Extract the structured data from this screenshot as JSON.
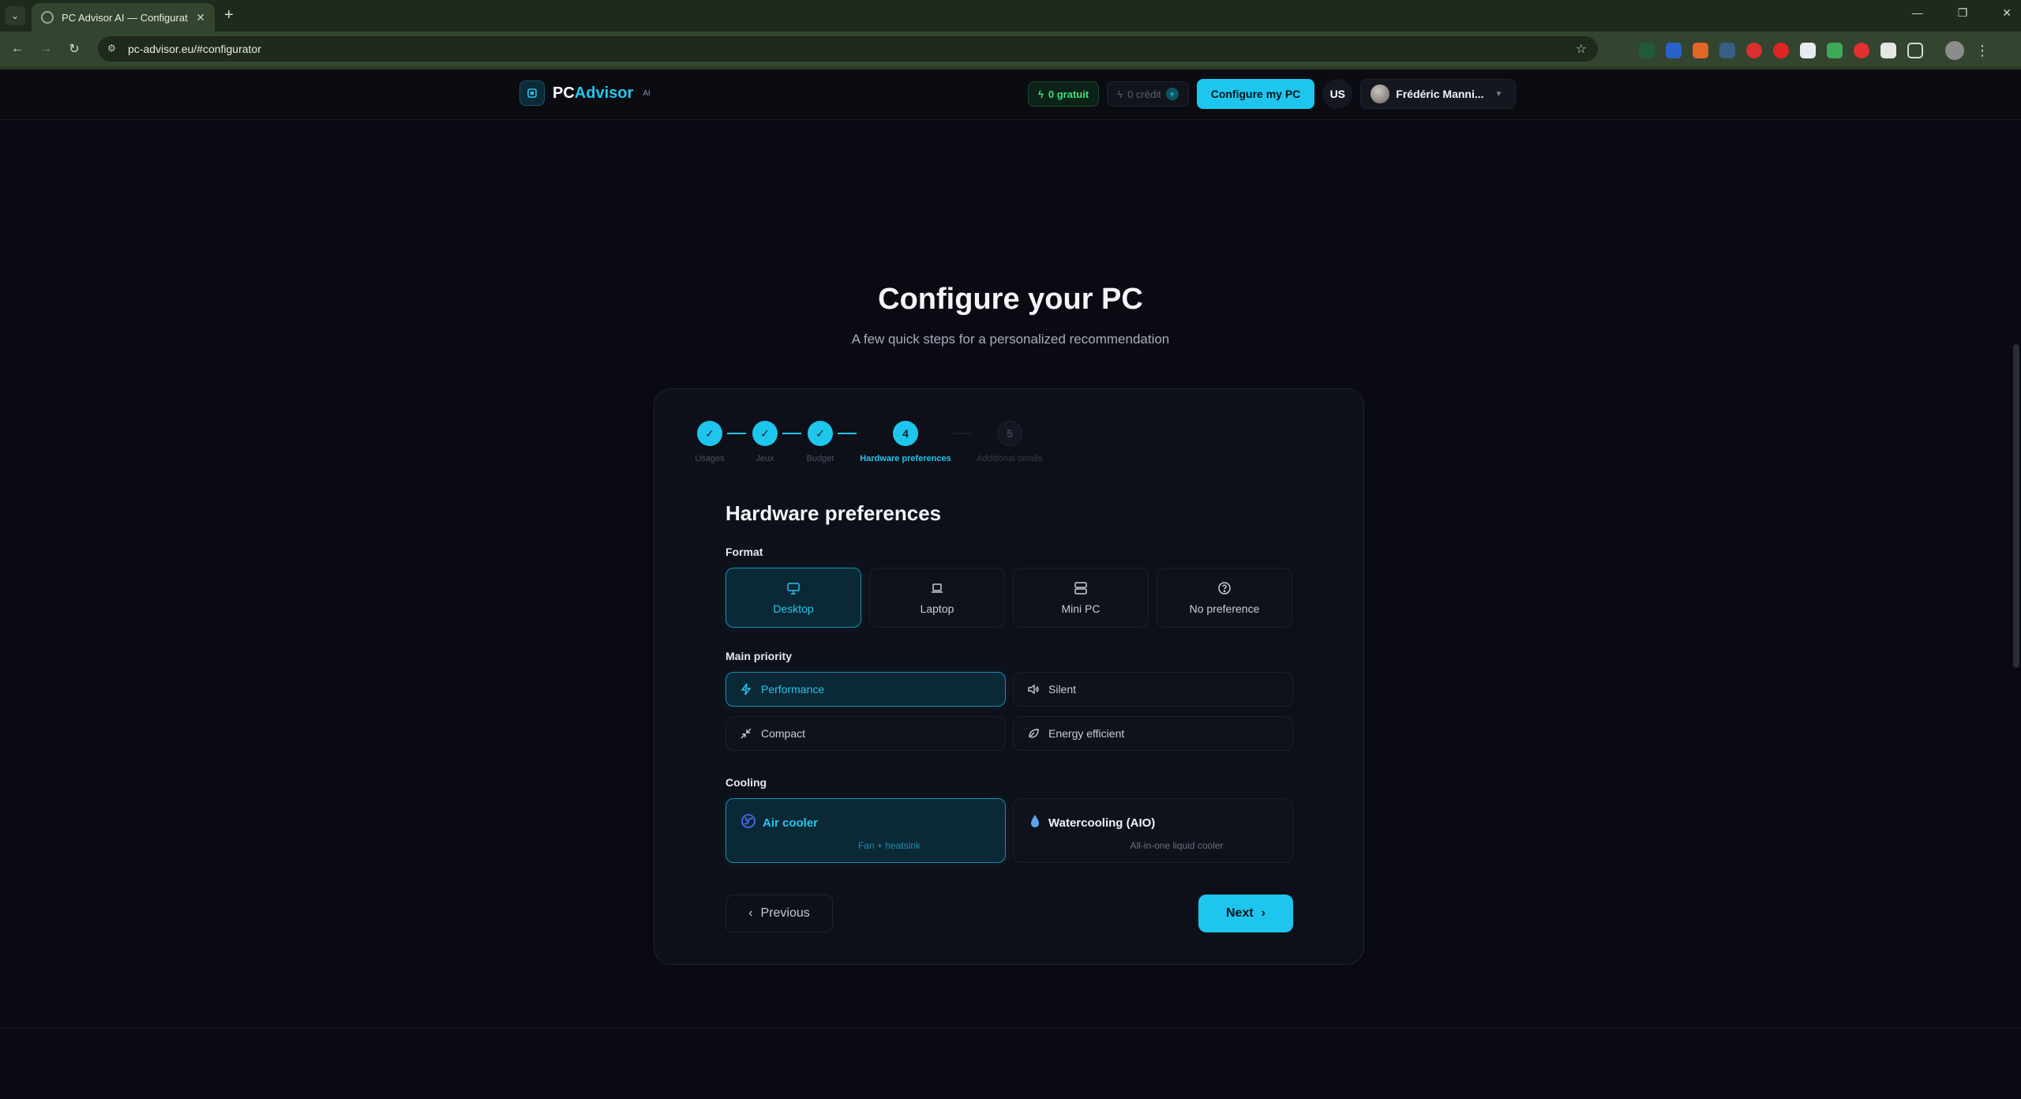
{
  "browser": {
    "tab_title": "PC Advisor AI — Configurateur",
    "url": "pc-advisor.eu/#configurator"
  },
  "header": {
    "brand_pc": "PC",
    "brand_advisor": "Advisor",
    "brand_ai": "AI",
    "free_label": "0 gratuit",
    "credit_label": "0 crédit",
    "configure_button": "Configure my PC",
    "lang": "US",
    "user_name": "Frédéric Manni..."
  },
  "hero": {
    "title": "Configure your PC",
    "subtitle": "A few quick steps for a personalized recommendation"
  },
  "stepper": {
    "steps": [
      {
        "label": "Usages",
        "mark": "✓",
        "state": "done"
      },
      {
        "label": "Jeux",
        "mark": "✓",
        "state": "done"
      },
      {
        "label": "Budget",
        "mark": "✓",
        "state": "done"
      },
      {
        "label": "Hardware preferences",
        "mark": "4",
        "state": "active"
      },
      {
        "label": "Additional details",
        "mark": "5",
        "state": "future"
      }
    ]
  },
  "form": {
    "section_title": "Hardware preferences",
    "format_label": "Format",
    "format_options": [
      {
        "label": "Desktop",
        "icon": "monitor-icon",
        "selected": true
      },
      {
        "label": "Laptop",
        "icon": "laptop-icon",
        "selected": false
      },
      {
        "label": "Mini PC",
        "icon": "server-icon",
        "selected": false
      },
      {
        "label": "No preference",
        "icon": "help-circle-icon",
        "selected": false
      }
    ],
    "priority_label": "Main priority",
    "priority_options": [
      {
        "label": "Performance",
        "icon": "zap-icon",
        "selected": true
      },
      {
        "label": "Silent",
        "icon": "volume-icon",
        "selected": false
      },
      {
        "label": "Compact",
        "icon": "minimize-icon",
        "selected": false
      },
      {
        "label": "Energy efficient",
        "icon": "leaf-icon",
        "selected": false
      }
    ],
    "cooling_label": "Cooling",
    "cooling_options": [
      {
        "label": "Air cooler",
        "desc": "Fan + heatsink",
        "icon": "fan-icon",
        "selected": true
      },
      {
        "label": "Watercooling (AIO)",
        "desc": "All-in-one liquid cooler",
        "icon": "droplet-icon",
        "selected": false
      }
    ],
    "prev_button": "Previous",
    "next_button": "Next"
  },
  "colors": {
    "accent": "#1ec6ee",
    "background": "#0a0b12",
    "card": "#0e1019",
    "success": "#3be07f"
  }
}
